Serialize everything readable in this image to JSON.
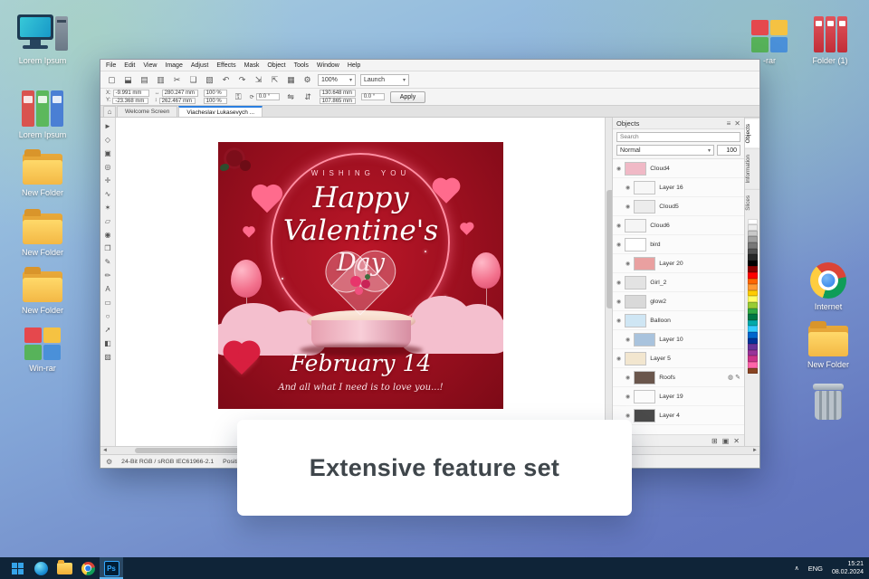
{
  "desktop": {
    "icons_left": [
      {
        "type": "computer",
        "label": "Lorem Ipsum"
      },
      {
        "type": "binders",
        "label": "Lorem Ipsum"
      },
      {
        "type": "folder",
        "label": "New Folder"
      },
      {
        "type": "folder",
        "label": "New Folder"
      },
      {
        "type": "folder",
        "label": "New Folder"
      },
      {
        "type": "winrar",
        "label": "Win-rar"
      }
    ],
    "icons_right_top": [
      {
        "type": "winrar",
        "label": "-rar"
      },
      {
        "type": "archive",
        "label": "Folder (1)"
      }
    ],
    "icons_right": [
      {
        "type": "chrome",
        "label": "Internet"
      },
      {
        "type": "folder",
        "label": "New Folder"
      },
      {
        "type": "trash",
        "label": ""
      }
    ]
  },
  "app": {
    "menu": [
      "File",
      "Edit",
      "View",
      "Image",
      "Adjust",
      "Effects",
      "Mask",
      "Object",
      "Tools",
      "Window",
      "Help"
    ],
    "toolbar": {
      "icons": [
        {
          "name": "new-document-icon",
          "glyph": "▢"
        },
        {
          "name": "open-icon",
          "glyph": "⬓"
        },
        {
          "name": "save-icon",
          "glyph": "▤"
        },
        {
          "name": "print-icon",
          "glyph": "▥"
        },
        {
          "name": "cut-icon",
          "glyph": "✂"
        },
        {
          "name": "copy-icon",
          "glyph": "❏"
        },
        {
          "name": "paste-icon",
          "glyph": "▧"
        },
        {
          "name": "undo-icon",
          "glyph": "↶"
        },
        {
          "name": "redo-icon",
          "glyph": "↷"
        },
        {
          "name": "import-icon",
          "glyph": "⇲"
        },
        {
          "name": "export-icon",
          "glyph": "⇱"
        },
        {
          "name": "grid-icon",
          "glyph": "▦"
        },
        {
          "name": "options-icon",
          "glyph": "⚙"
        }
      ],
      "zoom_value": "100%",
      "launch_label": "Launch"
    },
    "property_bar": {
      "x_label": "X:",
      "x_value": "-9.991 mm",
      "y_label": "Y:",
      "y_value": "-23.368 mm",
      "width_value": "280.247 mm",
      "height_value": "262.467 mm",
      "scale_x": "100 %",
      "scale_y": "100 %",
      "angle_value": "0.0 °",
      "size_w": "130.648 mm",
      "size_h": "107.865 mm",
      "angle2_value": "0.0 °",
      "apply_label": "Apply"
    },
    "tabs": [
      {
        "label": "Welcome Screen",
        "active": false
      },
      {
        "label": "Viacheslav Lukasevych ...",
        "active": true
      }
    ],
    "toolbox": [
      {
        "name": "pick-tool",
        "glyph": "►"
      },
      {
        "name": "shape-tool",
        "glyph": "◇"
      },
      {
        "name": "crop-tool",
        "glyph": "▣"
      },
      {
        "name": "zoom-tool",
        "glyph": "◎"
      },
      {
        "name": "pan-tool",
        "glyph": "✛"
      },
      {
        "name": "lasso-mask-tool",
        "glyph": "∿"
      },
      {
        "name": "magic-wand-tool",
        "glyph": "✶"
      },
      {
        "name": "eraser-tool",
        "glyph": "▱"
      },
      {
        "name": "red-eye-tool",
        "glyph": "◉"
      },
      {
        "name": "clone-tool",
        "glyph": "❐"
      },
      {
        "name": "paint-tool",
        "glyph": "✎"
      },
      {
        "name": "image-sprayer-tool",
        "glyph": "✏"
      },
      {
        "name": "text-tool",
        "glyph": "A"
      },
      {
        "name": "rectangle-tool",
        "glyph": "▭"
      },
      {
        "name": "ellipse-tool",
        "glyph": "○"
      },
      {
        "name": "line-tool",
        "glyph": "➚"
      },
      {
        "name": "fill-tool",
        "glyph": "◧"
      },
      {
        "name": "transparency-tool",
        "glyph": "▨"
      }
    ],
    "statusbar": {
      "left": "24-Bit RGB / sRGB IEC61966-2.1",
      "hint": "Positions the obj"
    }
  },
  "poster": {
    "wishing": "WISHING YOU",
    "line1": "Happy",
    "line2": "Valentine's",
    "line3": "Day",
    "date": "February 14",
    "tagline": "And all what I need is to love you...!"
  },
  "objects_panel": {
    "title": "Objects",
    "search_placeholder": "Search",
    "blend_mode": "Normal",
    "opacity": "100",
    "side_tabs": [
      "Objects",
      "Information",
      "Slices"
    ],
    "layers": [
      {
        "name": "Cloud4",
        "thumb": "#f0b9c6",
        "indent": 0
      },
      {
        "name": "Layer 16",
        "thumb": "#f7f7f7",
        "indent": 1
      },
      {
        "name": "Cloud5",
        "thumb": "#ececec",
        "indent": 1
      },
      {
        "name": "Cloud6",
        "thumb": "#f5f5f5",
        "indent": 0
      },
      {
        "name": "bird",
        "thumb": "#ffffff",
        "indent": 0
      },
      {
        "name": "Layer 20",
        "thumb": "#e9a0a0",
        "indent": 1
      },
      {
        "name": "Girl_2",
        "thumb": "#e3e3e3",
        "indent": 0
      },
      {
        "name": "glow2",
        "thumb": "#d9d9d9",
        "indent": 0
      },
      {
        "name": "Balloon",
        "thumb": "#cfe6f4",
        "indent": 0
      },
      {
        "name": "Layer 10",
        "thumb": "#a9c3dd",
        "indent": 1
      },
      {
        "name": "Layer 5",
        "thumb": "#f2e6cf",
        "indent": 0
      },
      {
        "name": "Roofs",
        "thumb": "#6a564c",
        "indent": 1,
        "marked": true
      },
      {
        "name": "Layer 19",
        "thumb": "#fbfbfb",
        "indent": 1
      },
      {
        "name": "Layer 4",
        "thumb": "#4a4a4a",
        "indent": 1
      }
    ]
  },
  "palette": [
    "#ffffff",
    "#ebebeb",
    "#c8c8c8",
    "#a0a0a0",
    "#787878",
    "#505050",
    "#282828",
    "#000000",
    "#8b0000",
    "#ff0000",
    "#ff6600",
    "#ff9933",
    "#ffcc00",
    "#ffff66",
    "#99cc33",
    "#33aa44",
    "#007744",
    "#00aaaa",
    "#33ccff",
    "#0066cc",
    "#003399",
    "#663399",
    "#993399",
    "#cc3388",
    "#ff66aa",
    "#884422"
  ],
  "overlay": {
    "text": "Extensive feature set"
  },
  "taskbar": {
    "photoshop_label": "Ps",
    "tray_caret": "∧",
    "lang": "ENG",
    "time": "15:21",
    "date": "08.02.2024"
  }
}
